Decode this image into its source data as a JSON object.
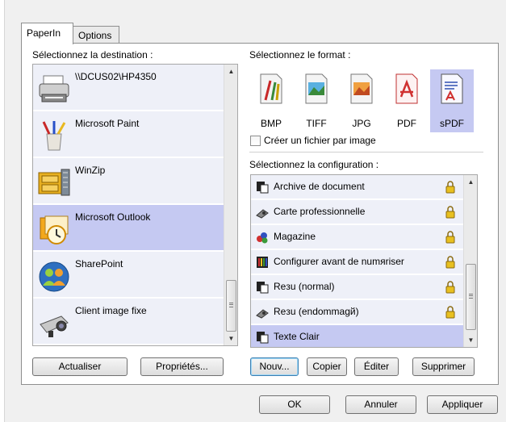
{
  "tabs": [
    {
      "label": "PaperIn"
    },
    {
      "label": "Options"
    }
  ],
  "destination": {
    "label": "Sélectionnez la destination :",
    "items": [
      {
        "label": "\\\\DCUS02\\HP4350",
        "icon": "printer-icon"
      },
      {
        "label": "Microsoft Paint",
        "icon": "paint-brushes-icon"
      },
      {
        "label": "WinZip",
        "icon": "winzip-cabinet-icon"
      },
      {
        "label": "Microsoft Outlook",
        "icon": "outlook-clock-icon",
        "selected": true
      },
      {
        "label": "SharePoint",
        "icon": "sharepoint-people-icon"
      },
      {
        "label": "Client image fixe",
        "icon": "camera-icon"
      }
    ],
    "buttons": {
      "refresh": "Actualiser",
      "properties": "Propriétés..."
    }
  },
  "format": {
    "label": "Sélectionnez le format :",
    "items": [
      {
        "label": "BMP",
        "color": "#c8a000"
      },
      {
        "label": "TIFF",
        "color": "#3a8a3a"
      },
      {
        "label": "JPG",
        "color": "#e07820"
      },
      {
        "label": "PDF",
        "color": "#d03030"
      },
      {
        "label": "sPDF",
        "color": "#3050b0",
        "selected": true
      }
    ],
    "checkbox": {
      "label": "Créer un fichier par image",
      "checked": false
    }
  },
  "configuration": {
    "label": "Sélectionnez la configuration :",
    "items": [
      {
        "label": "Archive de document",
        "icon": "document-icon",
        "locked": true
      },
      {
        "label": "Carte professionnelle",
        "icon": "card-icon",
        "locked": true
      },
      {
        "label": "Magazine",
        "icon": "magazine-icon",
        "locked": true
      },
      {
        "label": "Configurer avant de numяriser",
        "icon": "configure-icon",
        "locked": true
      },
      {
        "label": "Reзu (normal)",
        "icon": "document-icon",
        "locked": true
      },
      {
        "label": "Reзu (endommagй)",
        "icon": "card-icon",
        "locked": true
      },
      {
        "label": "Texte Clair",
        "icon": "document-icon",
        "locked": false,
        "selected": true
      }
    ],
    "buttons": {
      "new": "Nouv...",
      "copy": "Copier",
      "edit": "Éditer",
      "delete": "Supprimer"
    }
  },
  "dialog_buttons": {
    "ok": "OK",
    "cancel": "Annuler",
    "apply": "Appliquer"
  },
  "colors": {
    "selection": "#c5c9f2",
    "item_bg": "#eef0f8",
    "lock": "#e8c020"
  }
}
